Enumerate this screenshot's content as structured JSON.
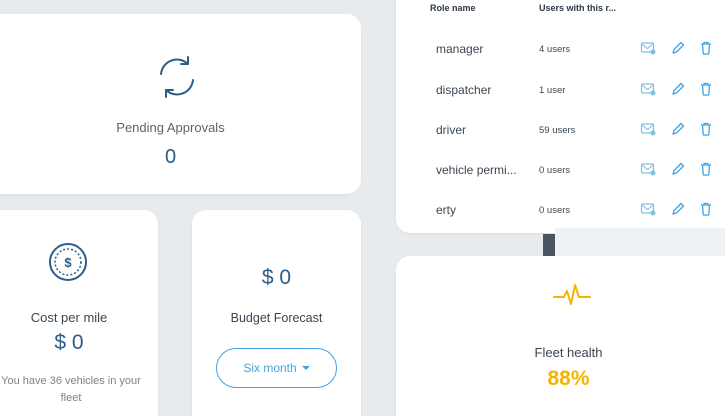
{
  "pending": {
    "label": "Pending Approvals",
    "value": "0",
    "icon": "sync-icon"
  },
  "cost": {
    "label": "Cost per mile",
    "value": "$ 0",
    "note": "You have 36 vehicles in your fleet",
    "icon": "dollar-coin-icon"
  },
  "budget": {
    "value": "$ 0",
    "label": "Budget Forecast",
    "dropdown_value": "Six month"
  },
  "roles": {
    "headers": [
      "Role name",
      "Users with this r..."
    ],
    "rows": [
      {
        "name": "manager",
        "users": "4 users"
      },
      {
        "name": "dispatcher",
        "users": "1 user"
      },
      {
        "name": "driver",
        "users": "59 users"
      },
      {
        "name": "vehicle permi...",
        "users": "0 users"
      },
      {
        "name": "erty",
        "users": "0 users"
      }
    ],
    "actions": [
      "message-icon",
      "pencil-icon",
      "trash-icon"
    ]
  },
  "health": {
    "label": "Fleet health",
    "value": "88%",
    "icon": "heartbeat-icon",
    "color": "#f5b400"
  },
  "colors": {
    "accent": "#3fa4e0",
    "value_blue": "#2b5c8a",
    "warning": "#f5b400"
  }
}
